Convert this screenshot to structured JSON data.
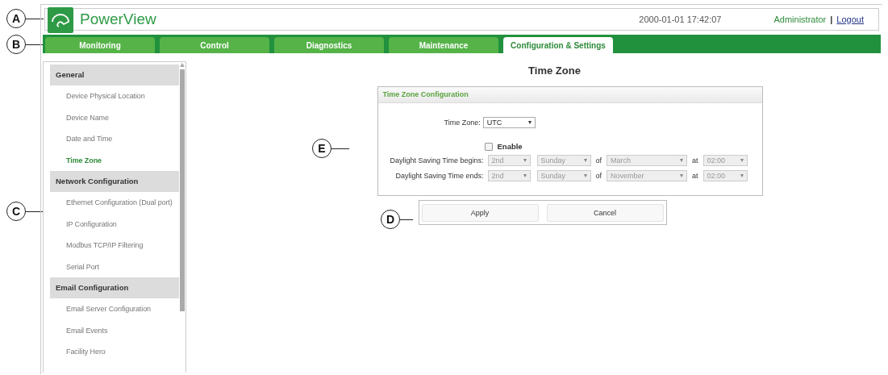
{
  "callouts": [
    {
      "letter": "A",
      "kind": "header"
    },
    {
      "letter": "B",
      "kind": "tabs"
    },
    {
      "letter": "C",
      "kind": "sidebar"
    },
    {
      "letter": "E",
      "kind": "config"
    },
    {
      "letter": "D",
      "kind": "buttons"
    }
  ],
  "header": {
    "app_name": "PowerView",
    "datetime": "2000-01-01 17:42:07",
    "user": "Administrator",
    "separator": "|",
    "logout": "Logout"
  },
  "tabs": [
    {
      "label": "Monitoring",
      "selected": false
    },
    {
      "label": "Control",
      "selected": false
    },
    {
      "label": "Diagnostics",
      "selected": false
    },
    {
      "label": "Maintenance",
      "selected": false
    },
    {
      "label": "Configuration & Settings",
      "selected": true
    }
  ],
  "sidebar": {
    "groups": [
      {
        "title": "General",
        "items": [
          {
            "label": "Device Physical Location",
            "selected": false
          },
          {
            "label": "Device Name",
            "selected": false
          },
          {
            "label": "Date and Time",
            "selected": false
          },
          {
            "label": "Time Zone",
            "selected": true
          }
        ]
      },
      {
        "title": "Network Configuration",
        "items": [
          {
            "label": "Ethernet Configuration (Dual port)",
            "selected": false
          },
          {
            "label": "IP Configuration",
            "selected": false
          },
          {
            "label": "Modbus TCP/IP Filtering",
            "selected": false
          },
          {
            "label": "Serial Port",
            "selected": false
          }
        ]
      },
      {
        "title": "Email Configuration",
        "items": [
          {
            "label": "Email Server Configuration",
            "selected": false
          },
          {
            "label": "Email Events",
            "selected": false
          },
          {
            "label": "Facility Hero",
            "selected": false
          }
        ]
      }
    ]
  },
  "page_title": "Time Zone",
  "panel": {
    "title": "Time Zone Configuration",
    "time_zone": {
      "label": "Time Zone:",
      "value": "UTC"
    },
    "dst": {
      "enable_label": "Enable",
      "checked": false,
      "rows": [
        {
          "label": "Daylight Saving Time begins:",
          "week": "2nd",
          "day": "Sunday",
          "of": "of",
          "month": "March",
          "at": "at",
          "time": "02:00",
          "disabled": true
        },
        {
          "label": "Daylight Saving Time ends:",
          "week": "2nd",
          "day": "Sunday",
          "of": "of",
          "month": "November",
          "at": "at",
          "time": "02:00",
          "disabled": true
        }
      ]
    }
  },
  "buttons": [
    "Apply",
    "Cancel"
  ]
}
